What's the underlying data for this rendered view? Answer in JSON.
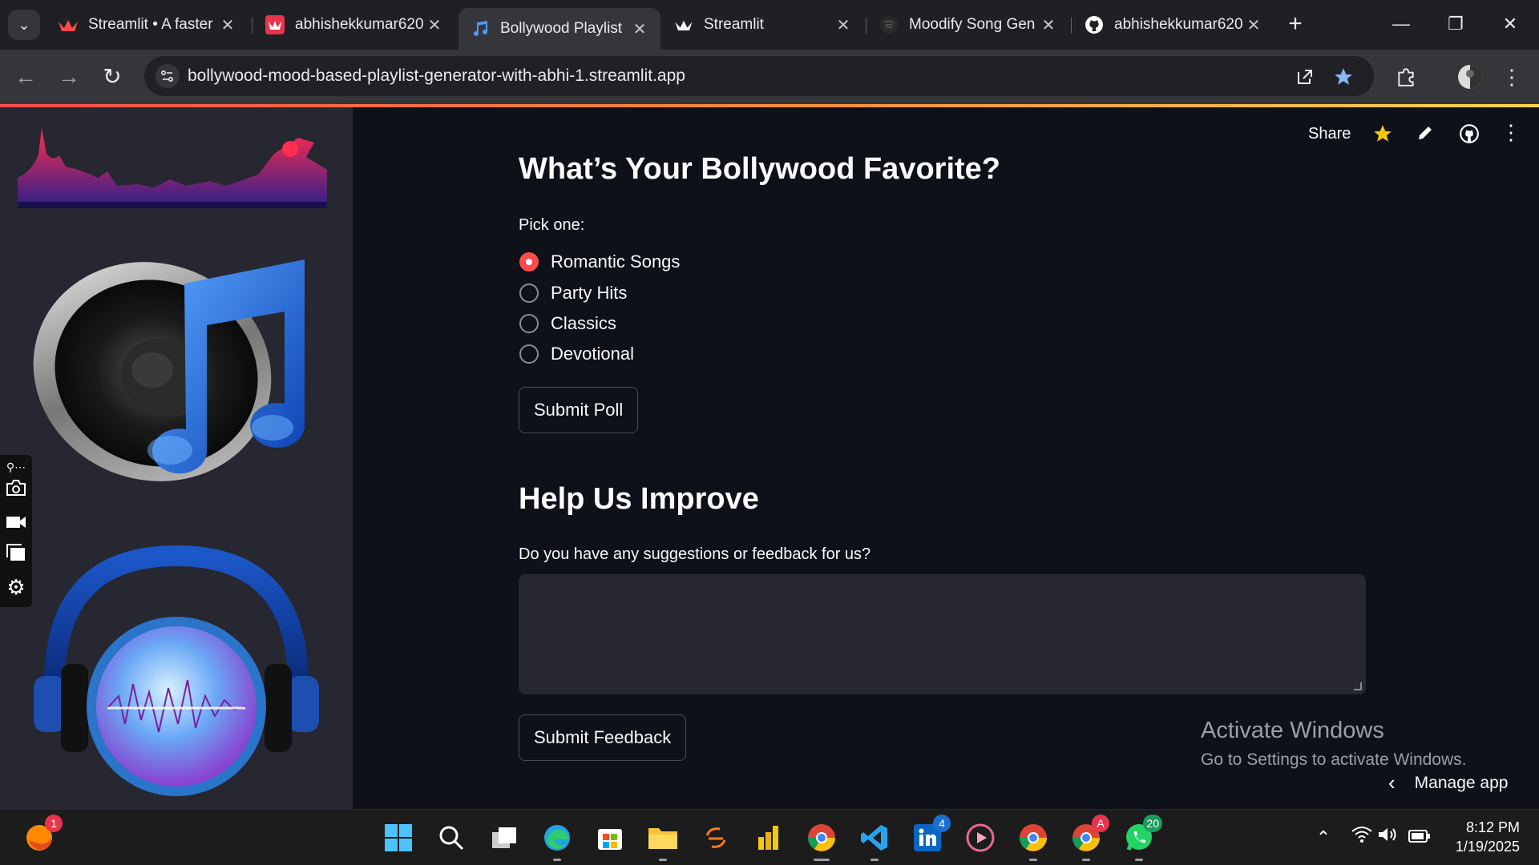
{
  "browser": {
    "tabs": [
      {
        "title": "Streamlit • A faster",
        "icon": "streamlit-crown-icon"
      },
      {
        "title": "abhishekkumar620",
        "icon": "streamlit-crown-red-icon"
      },
      {
        "title": "Bollywood Playlist",
        "icon": "music-note-icon",
        "active": true
      },
      {
        "title": "Streamlit",
        "icon": "streamlit-crown-icon"
      },
      {
        "title": "Moodify Song Gen",
        "icon": "spotify-icon"
      },
      {
        "title": "abhishekkumar620",
        "icon": "github-icon"
      }
    ],
    "url": "bollywood-mood-based-playlist-generator-with-abhi-1.streamlit.app"
  },
  "app_header": {
    "share_label": "Share"
  },
  "poll": {
    "title": "What’s Your Bollywood Favorite?",
    "prompt": "Pick one:",
    "options": [
      "Romantic Songs",
      "Party Hits",
      "Classics",
      "Devotional"
    ],
    "selected": "Romantic Songs",
    "submit_label": "Submit Poll"
  },
  "feedback": {
    "title": "Help Us Improve",
    "prompt": "Do you have any suggestions or feedback for us?",
    "value": "",
    "submit_label": "Submit Feedback"
  },
  "watermark": {
    "line1": "Activate Windows",
    "line2": "Go to Settings to activate Windows."
  },
  "manage_app_label": "Manage app",
  "taskbar": {
    "badges": {
      "firefox": "1",
      "linkedin": "4",
      "chrome_a": "A",
      "whatsapp": "20"
    },
    "time": "8:12 PM",
    "date": "1/19/2025"
  },
  "colors": {
    "accent": "#ff4b4b",
    "background": "#0e1117",
    "sidebar": "#262730"
  }
}
